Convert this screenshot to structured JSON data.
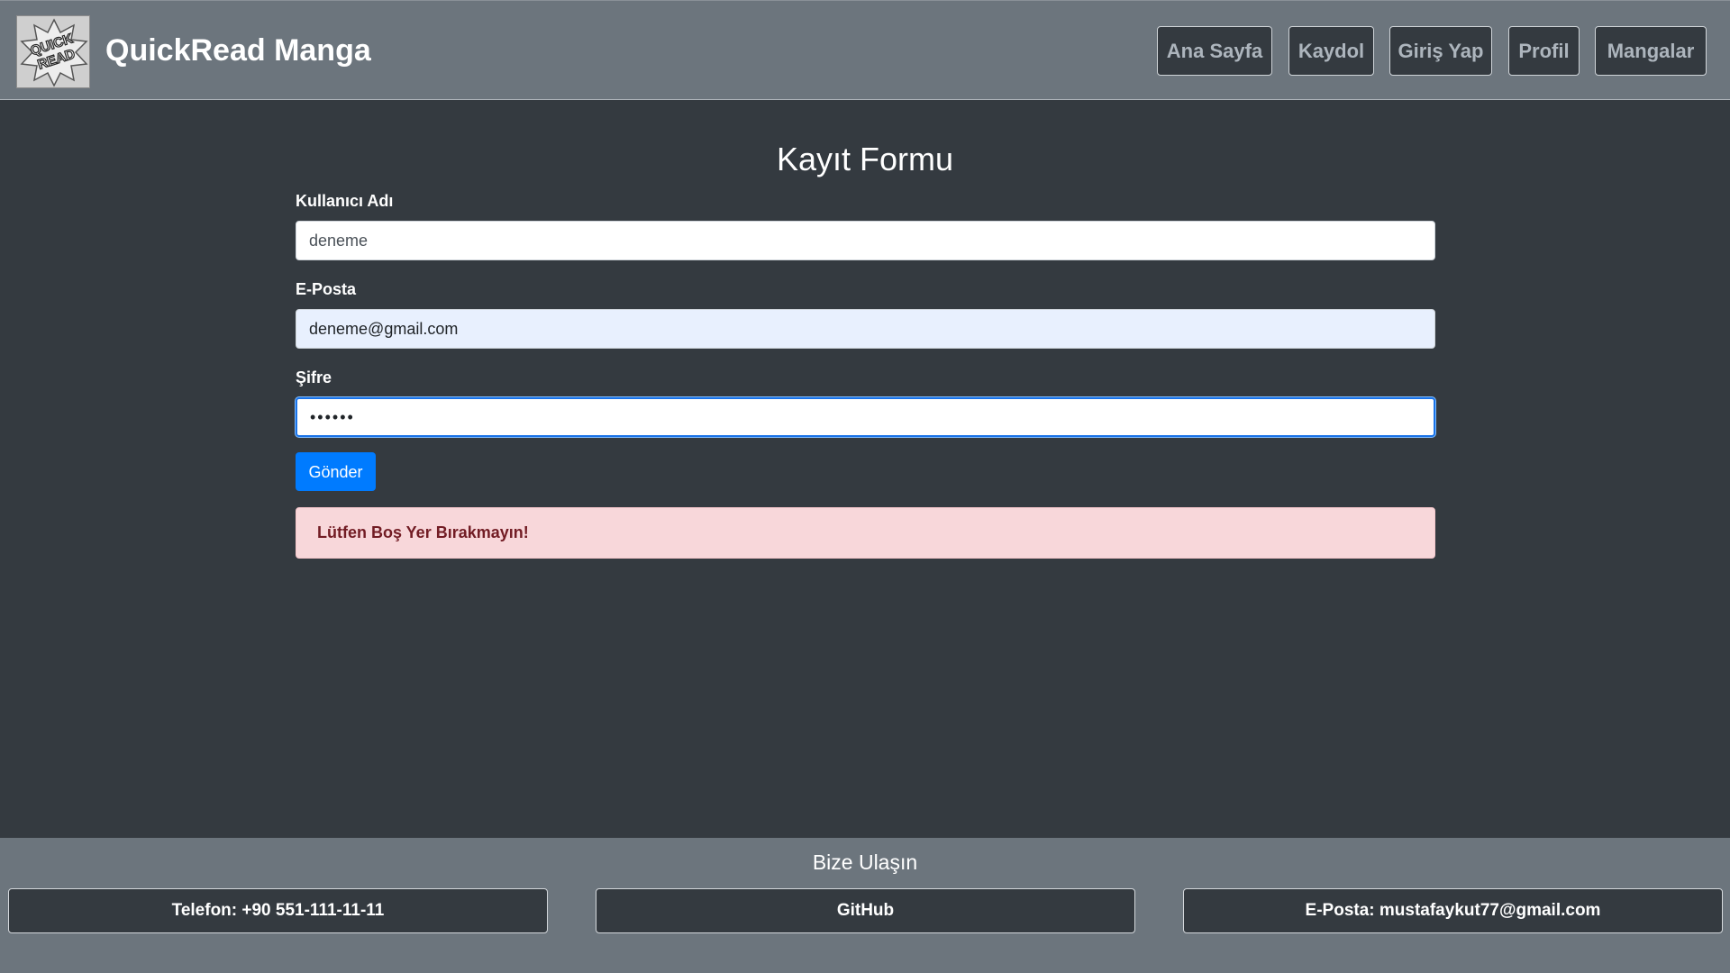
{
  "header": {
    "brand": "QuickRead Manga",
    "logo_text": [
      "QUICK",
      "READ"
    ],
    "nav": [
      {
        "label": "Ana Sayfa"
      },
      {
        "label": "Kaydol"
      },
      {
        "label": "Giriş Yap"
      },
      {
        "label": "Profil"
      },
      {
        "label": "Mangalar"
      }
    ]
  },
  "form": {
    "title": "Kayıt Formu",
    "username": {
      "label": "Kullanıcı Adı",
      "value": "deneme"
    },
    "email": {
      "label": "E-Posta",
      "value": "deneme@gmail.com"
    },
    "password": {
      "label": "Şifre",
      "value": "••••••"
    },
    "submit_label": "Gönder",
    "alert": "Lütfen Boş Yer Bırakmayın!"
  },
  "footer": {
    "title": "Bize Ulaşın",
    "phone": "Telefon: +90 551-111-11-11",
    "github": "GitHub",
    "email": "E-Posta: mustafaykut77@gmail.com"
  },
  "colors": {
    "header_bg": "#6c757d",
    "page_bg": "#343a40",
    "primary": "#007bff",
    "alert_bg": "#f8d7da",
    "alert_text": "#721c24"
  }
}
